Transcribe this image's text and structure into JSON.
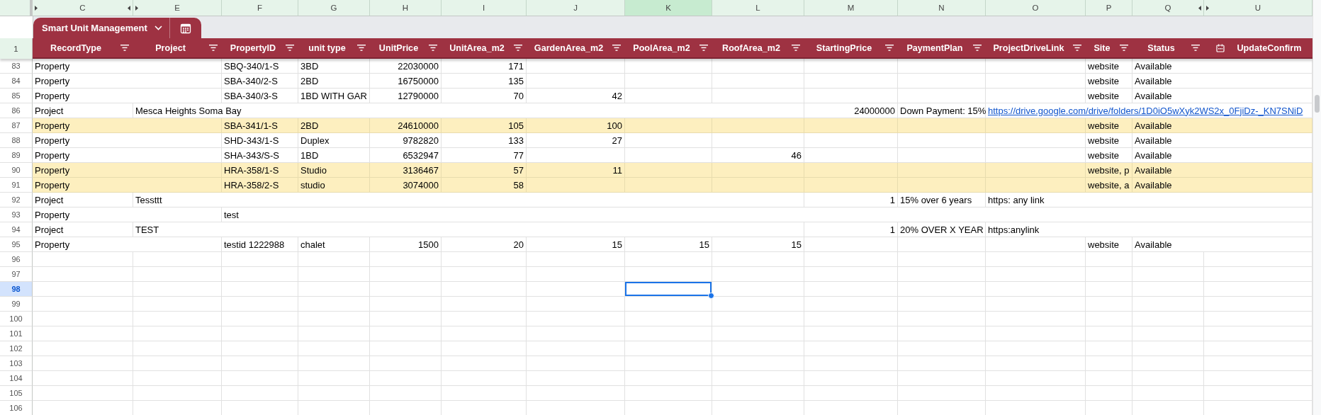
{
  "table": {
    "name": "Smart Unit Management",
    "header_row_number": "1",
    "columns": [
      {
        "letter": "C",
        "header": "RecordType",
        "kind": "text",
        "selected": false,
        "hidden_before": true,
        "hidden_after": true
      },
      {
        "letter": "E",
        "header": "Project",
        "kind": "text",
        "selected": false,
        "hidden_before": true,
        "hidden_after": false
      },
      {
        "letter": "F",
        "header": "PropertyID",
        "kind": "text",
        "selected": false,
        "hidden_before": false,
        "hidden_after": false
      },
      {
        "letter": "G",
        "header": "unit type",
        "kind": "text",
        "selected": false,
        "hidden_before": false,
        "hidden_after": false
      },
      {
        "letter": "H",
        "header": "UnitPrice",
        "kind": "text",
        "selected": false,
        "hidden_before": false,
        "hidden_after": false
      },
      {
        "letter": "I",
        "header": "UnitArea_m2",
        "kind": "text",
        "selected": false,
        "hidden_before": false,
        "hidden_after": false
      },
      {
        "letter": "J",
        "header": "GardenArea_m2",
        "kind": "text",
        "selected": false,
        "hidden_before": false,
        "hidden_after": false
      },
      {
        "letter": "K",
        "header": "PoolArea_m2",
        "kind": "text",
        "selected": true,
        "hidden_before": false,
        "hidden_after": false
      },
      {
        "letter": "L",
        "header": "RoofArea_m2",
        "kind": "text",
        "selected": false,
        "hidden_before": false,
        "hidden_after": false
      },
      {
        "letter": "M",
        "header": "StartingPrice",
        "kind": "text",
        "selected": false,
        "hidden_before": false,
        "hidden_after": false
      },
      {
        "letter": "N",
        "header": "PaymentPlan",
        "kind": "text",
        "selected": false,
        "hidden_before": false,
        "hidden_after": false
      },
      {
        "letter": "O",
        "header": "ProjectDriveLink",
        "kind": "text",
        "selected": false,
        "hidden_before": false,
        "hidden_after": false
      },
      {
        "letter": "P",
        "header": "Site",
        "kind": "text",
        "selected": false,
        "hidden_before": false,
        "hidden_after": false
      },
      {
        "letter": "Q",
        "header": "Status",
        "kind": "text",
        "selected": false,
        "hidden_before": false,
        "hidden_after": true
      },
      {
        "letter": "U",
        "header": "UpdateConfirm",
        "kind": "date",
        "selected": false,
        "hidden_before": true,
        "hidden_after": false
      }
    ],
    "rows": [
      {
        "number": "83",
        "highlighted": false,
        "selected": false,
        "cells": {
          "C": {
            "kind": "text",
            "text": "Property"
          },
          "F": {
            "kind": "text",
            "text": "SBQ-340/1-S"
          },
          "G": {
            "kind": "text",
            "text": "3BD"
          },
          "H": {
            "kind": "number",
            "text": "22030000"
          },
          "I": {
            "kind": "number",
            "text": "171"
          },
          "P": {
            "kind": "text",
            "text": "website"
          },
          "Q": {
            "kind": "text",
            "text": "Available"
          }
        }
      },
      {
        "number": "84",
        "highlighted": false,
        "selected": false,
        "cells": {
          "C": {
            "kind": "text",
            "text": "Property"
          },
          "F": {
            "kind": "text",
            "text": "SBA-340/2-S"
          },
          "G": {
            "kind": "text",
            "text": "2BD"
          },
          "H": {
            "kind": "number",
            "text": "16750000"
          },
          "I": {
            "kind": "number",
            "text": "135"
          },
          "P": {
            "kind": "text",
            "text": "website"
          },
          "Q": {
            "kind": "text",
            "text": "Available"
          }
        }
      },
      {
        "number": "85",
        "highlighted": false,
        "selected": false,
        "cells": {
          "C": {
            "kind": "text",
            "text": "Property"
          },
          "F": {
            "kind": "text",
            "text": "SBA-340/3-S"
          },
          "G": {
            "kind": "text",
            "text": "1BD WITH GAR"
          },
          "H": {
            "kind": "number",
            "text": "12790000"
          },
          "I": {
            "kind": "number",
            "text": "70"
          },
          "J": {
            "kind": "number",
            "text": "42"
          },
          "P": {
            "kind": "text",
            "text": "website"
          },
          "Q": {
            "kind": "text",
            "text": "Available"
          }
        }
      },
      {
        "number": "86",
        "highlighted": false,
        "selected": false,
        "cells": {
          "C": {
            "kind": "text",
            "text": "Project"
          },
          "E": {
            "kind": "text",
            "text": "Mesca Heights Soma Bay"
          },
          "M": {
            "kind": "number",
            "text": "24000000"
          },
          "N": {
            "kind": "text",
            "text": "Down Payment: 15%"
          },
          "O": {
            "kind": "link",
            "text": "https://drive.google.com/drive/folders/1D0iO5wXyk2WS2x_0FjiDz-_KN7SNiD"
          }
        }
      },
      {
        "number": "87",
        "highlighted": true,
        "selected": false,
        "cells": {
          "C": {
            "kind": "text",
            "text": "Property"
          },
          "F": {
            "kind": "text",
            "text": "SBA-341/1-S"
          },
          "G": {
            "kind": "text",
            "text": "2BD"
          },
          "H": {
            "kind": "number",
            "text": "24610000"
          },
          "I": {
            "kind": "number",
            "text": "105"
          },
          "J": {
            "kind": "number",
            "text": "100"
          },
          "P": {
            "kind": "text",
            "text": "website"
          },
          "Q": {
            "kind": "text",
            "text": "Available"
          }
        }
      },
      {
        "number": "88",
        "highlighted": false,
        "selected": false,
        "cells": {
          "C": {
            "kind": "text",
            "text": "Property"
          },
          "F": {
            "kind": "text",
            "text": "SHD-343/1-S"
          },
          "G": {
            "kind": "text",
            "text": "Duplex"
          },
          "H": {
            "kind": "number",
            "text": "9782820"
          },
          "I": {
            "kind": "number",
            "text": "133"
          },
          "J": {
            "kind": "number",
            "text": "27"
          },
          "P": {
            "kind": "text",
            "text": "website"
          },
          "Q": {
            "kind": "text",
            "text": "Available"
          }
        }
      },
      {
        "number": "89",
        "highlighted": false,
        "selected": false,
        "cells": {
          "C": {
            "kind": "text",
            "text": "Property"
          },
          "F": {
            "kind": "text",
            "text": "SHA-343/S-S"
          },
          "G": {
            "kind": "text",
            "text": "1BD"
          },
          "H": {
            "kind": "number",
            "text": "6532947"
          },
          "I": {
            "kind": "number",
            "text": "77"
          },
          "L": {
            "kind": "number",
            "text": "46"
          },
          "P": {
            "kind": "text",
            "text": "website"
          },
          "Q": {
            "kind": "text",
            "text": "Available"
          }
        }
      },
      {
        "number": "90",
        "highlighted": true,
        "selected": false,
        "cells": {
          "C": {
            "kind": "text",
            "text": "Property"
          },
          "F": {
            "kind": "text",
            "text": "HRA-358/1-S"
          },
          "G": {
            "kind": "text",
            "text": "Studio"
          },
          "H": {
            "kind": "number",
            "text": "3136467"
          },
          "I": {
            "kind": "number",
            "text": "57"
          },
          "J": {
            "kind": "number",
            "text": "11"
          },
          "P": {
            "kind": "text",
            "text": "website, p"
          },
          "Q": {
            "kind": "text",
            "text": "Available"
          }
        }
      },
      {
        "number": "91",
        "highlighted": true,
        "selected": false,
        "cells": {
          "C": {
            "kind": "text",
            "text": "Property"
          },
          "F": {
            "kind": "text",
            "text": "HRA-358/2-S"
          },
          "G": {
            "kind": "text",
            "text": "studio"
          },
          "H": {
            "kind": "number",
            "text": "3074000"
          },
          "I": {
            "kind": "number",
            "text": "58"
          },
          "P": {
            "kind": "text",
            "text": "website, a"
          },
          "Q": {
            "kind": "text",
            "text": "Available"
          }
        }
      },
      {
        "number": "92",
        "highlighted": false,
        "selected": false,
        "cells": {
          "C": {
            "kind": "text",
            "text": "Project"
          },
          "E": {
            "kind": "text",
            "text": "Tessttt"
          },
          "M": {
            "kind": "number",
            "text": "1"
          },
          "N": {
            "kind": "text",
            "text": "15% over 6 years"
          },
          "O": {
            "kind": "text",
            "text": "https: any link"
          }
        }
      },
      {
        "number": "93",
        "highlighted": false,
        "selected": false,
        "cells": {
          "C": {
            "kind": "text",
            "text": "Property"
          },
          "F": {
            "kind": "text",
            "text": "test"
          }
        }
      },
      {
        "number": "94",
        "highlighted": false,
        "selected": false,
        "cells": {
          "C": {
            "kind": "text",
            "text": "Project"
          },
          "E": {
            "kind": "text",
            "text": "TEST"
          },
          "M": {
            "kind": "number",
            "text": "1"
          },
          "N": {
            "kind": "text",
            "text": "20% OVER X YEAR"
          },
          "O": {
            "kind": "text",
            "text": "https:anylink"
          }
        }
      },
      {
        "number": "95",
        "highlighted": false,
        "selected": false,
        "cells": {
          "C": {
            "kind": "text",
            "text": "Property"
          },
          "F": {
            "kind": "text",
            "text": "testid 1222988"
          },
          "G": {
            "kind": "text",
            "text": "chalet"
          },
          "H": {
            "kind": "number",
            "text": "1500"
          },
          "I": {
            "kind": "number",
            "text": "20"
          },
          "J": {
            "kind": "number",
            "text": "15"
          },
          "K": {
            "kind": "number",
            "text": "15"
          },
          "L": {
            "kind": "number",
            "text": "15"
          },
          "P": {
            "kind": "text",
            "text": "website"
          },
          "Q": {
            "kind": "text",
            "text": "Available"
          }
        }
      },
      {
        "number": "96",
        "highlighted": false,
        "selected": false
      },
      {
        "number": "97",
        "highlighted": false,
        "selected": false
      },
      {
        "number": "98",
        "highlighted": false,
        "selected": true
      },
      {
        "number": "99",
        "highlighted": false,
        "selected": false
      },
      {
        "number": "100",
        "highlighted": false,
        "selected": false
      },
      {
        "number": "101",
        "highlighted": false,
        "selected": false
      },
      {
        "number": "102",
        "highlighted": false,
        "selected": false
      },
      {
        "number": "103",
        "highlighted": false,
        "selected": false
      },
      {
        "number": "104",
        "highlighted": false,
        "selected": false
      },
      {
        "number": "105",
        "highlighted": false,
        "selected": false
      },
      {
        "number": "106",
        "highlighted": false,
        "selected": false
      }
    ]
  }
}
